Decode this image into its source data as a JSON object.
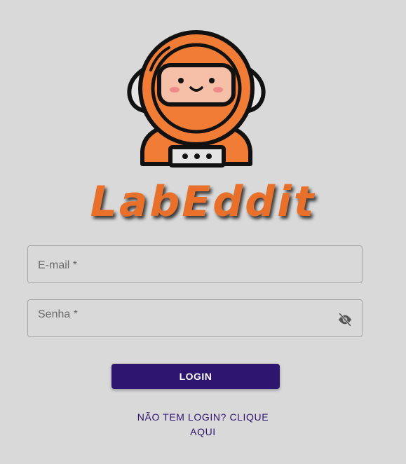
{
  "brand": {
    "logo_icon": "astronaut-icon",
    "name": "LabEddit",
    "accent_color": "#e8702a"
  },
  "form": {
    "email_label": "E-mail *",
    "password_label": "Senha *",
    "password_toggle_icon": "eye-off-icon",
    "login_label": "LOGIN",
    "login_color": "#2e1670"
  },
  "signup": {
    "line1": "NÃO TEM LOGIN? CLIQUE",
    "line2": "AQUI"
  }
}
